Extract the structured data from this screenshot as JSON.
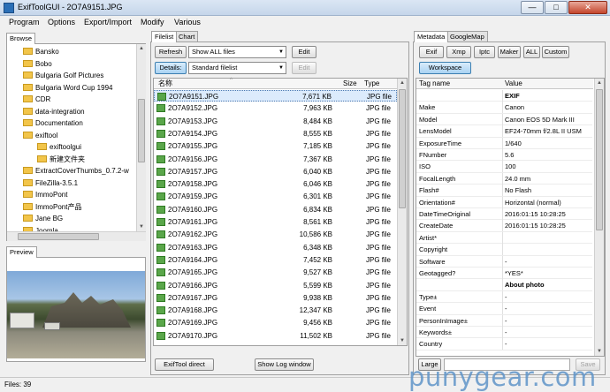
{
  "window": {
    "title": "ExifToolGUI - 2O7A9151.JPG",
    "min": "—",
    "max": "□",
    "close": "✕"
  },
  "menu": [
    "Program",
    "Options",
    "Export/Import",
    "Modify",
    "Various"
  ],
  "left": {
    "tab_browse": "Browse",
    "folders": [
      "Bansko",
      "Bobo",
      "Bulgaria Golf Pictures",
      "Bulgaria Word Cup 1994",
      "CDR",
      "data-integration",
      "Documentation",
      "exiftool",
      "exiftoolgui",
      "新建文件夹",
      "ExtractCoverThumbs_0.7.2-w",
      "FileZilla-3.5.1",
      "ImmoPont",
      "ImmoPont产品",
      "Jane BG",
      "Joomla"
    ],
    "tab_preview": "Preview"
  },
  "middle": {
    "tab_filelist": "Filelist",
    "tab_chart": "Chart",
    "refresh_label": "Refresh",
    "filter_value": "Show ALL files",
    "edit_label": "Edit",
    "details_label": "Details:",
    "view_value": "Standard filelist",
    "edit2_label": "Edit",
    "col_name": "名称",
    "col_size": "Size",
    "col_type": "Type",
    "files": [
      {
        "name": "2O7A9151.JPG",
        "size": "7,671 KB",
        "type": "JPG file"
      },
      {
        "name": "2O7A9152.JPG",
        "size": "7,963 KB",
        "type": "JPG file"
      },
      {
        "name": "2O7A9153.JPG",
        "size": "8,484 KB",
        "type": "JPG file"
      },
      {
        "name": "2O7A9154.JPG",
        "size": "8,555 KB",
        "type": "JPG file"
      },
      {
        "name": "2O7A9155.JPG",
        "size": "7,185 KB",
        "type": "JPG file"
      },
      {
        "name": "2O7A9156.JPG",
        "size": "7,367 KB",
        "type": "JPG file"
      },
      {
        "name": "2O7A9157.JPG",
        "size": "6,040 KB",
        "type": "JPG file"
      },
      {
        "name": "2O7A9158.JPG",
        "size": "6,046 KB",
        "type": "JPG file"
      },
      {
        "name": "2O7A9159.JPG",
        "size": "6,301 KB",
        "type": "JPG file"
      },
      {
        "name": "2O7A9160.JPG",
        "size": "6,834 KB",
        "type": "JPG file"
      },
      {
        "name": "2O7A9161.JPG",
        "size": "8,561 KB",
        "type": "JPG file"
      },
      {
        "name": "2O7A9162.JPG",
        "size": "10,586 KB",
        "type": "JPG file"
      },
      {
        "name": "2O7A9163.JPG",
        "size": "6,348 KB",
        "type": "JPG file"
      },
      {
        "name": "2O7A9164.JPG",
        "size": "7,452 KB",
        "type": "JPG file"
      },
      {
        "name": "2O7A9165.JPG",
        "size": "9,527 KB",
        "type": "JPG file"
      },
      {
        "name": "2O7A9166.JPG",
        "size": "5,599 KB",
        "type": "JPG file"
      },
      {
        "name": "2O7A9167.JPG",
        "size": "9,938 KB",
        "type": "JPG file"
      },
      {
        "name": "2O7A9168.JPG",
        "size": "12,347 KB",
        "type": "JPG file"
      },
      {
        "name": "2O7A9169.JPG",
        "size": "9,456 KB",
        "type": "JPG file"
      },
      {
        "name": "2O7A9170.JPG",
        "size": "11,502 KB",
        "type": "JPG file"
      }
    ],
    "exiftool_direct_label": "ExifTool direct",
    "show_log_label": "Show Log window"
  },
  "right": {
    "tab_metadata": "Metadata",
    "tab_googlemap": "GoogleMap",
    "buttons": [
      "Exif",
      "Xmp",
      "Iptc",
      "Maker",
      "ALL",
      "Custom"
    ],
    "workspace_label": "Workspace",
    "col_tag": "Tag name",
    "col_value": "Value",
    "rows": [
      {
        "k": "",
        "v": "EXIF",
        "bold": true
      },
      {
        "k": "Make",
        "v": "Canon"
      },
      {
        "k": "Model",
        "v": "Canon EOS 5D Mark III"
      },
      {
        "k": "LensModel",
        "v": "EF24-70mm f/2.8L II USM"
      },
      {
        "k": "ExposureTime",
        "v": "1/640"
      },
      {
        "k": "FNumber",
        "v": "5.6"
      },
      {
        "k": "ISO",
        "v": "100"
      },
      {
        "k": "FocalLength",
        "v": "24.0 mm"
      },
      {
        "k": "Flash#",
        "v": "No Flash"
      },
      {
        "k": "Orientation#",
        "v": "Horizontal (normal)"
      },
      {
        "k": "DateTimeOriginal",
        "v": "2016:01:15 10:28:25"
      },
      {
        "k": "CreateDate",
        "v": "2016:01:15 10:28:25"
      },
      {
        "k": "Artist*",
        "v": ""
      },
      {
        "k": "Copyright",
        "v": ""
      },
      {
        "k": "Software",
        "v": "-"
      },
      {
        "k": "Geotagged?",
        "v": "*YES*"
      },
      {
        "k": "",
        "v": "About photo",
        "bold": true
      },
      {
        "k": "Type±",
        "v": "-"
      },
      {
        "k": "Event",
        "v": "-"
      },
      {
        "k": "PersonInImage±",
        "v": "-"
      },
      {
        "k": "Keywords±",
        "v": "-"
      },
      {
        "k": "Country",
        "v": "-"
      }
    ],
    "large_label": "Large",
    "save_label": "Save"
  },
  "status": {
    "files": "Files: 39"
  },
  "watermark": "punygear.com"
}
